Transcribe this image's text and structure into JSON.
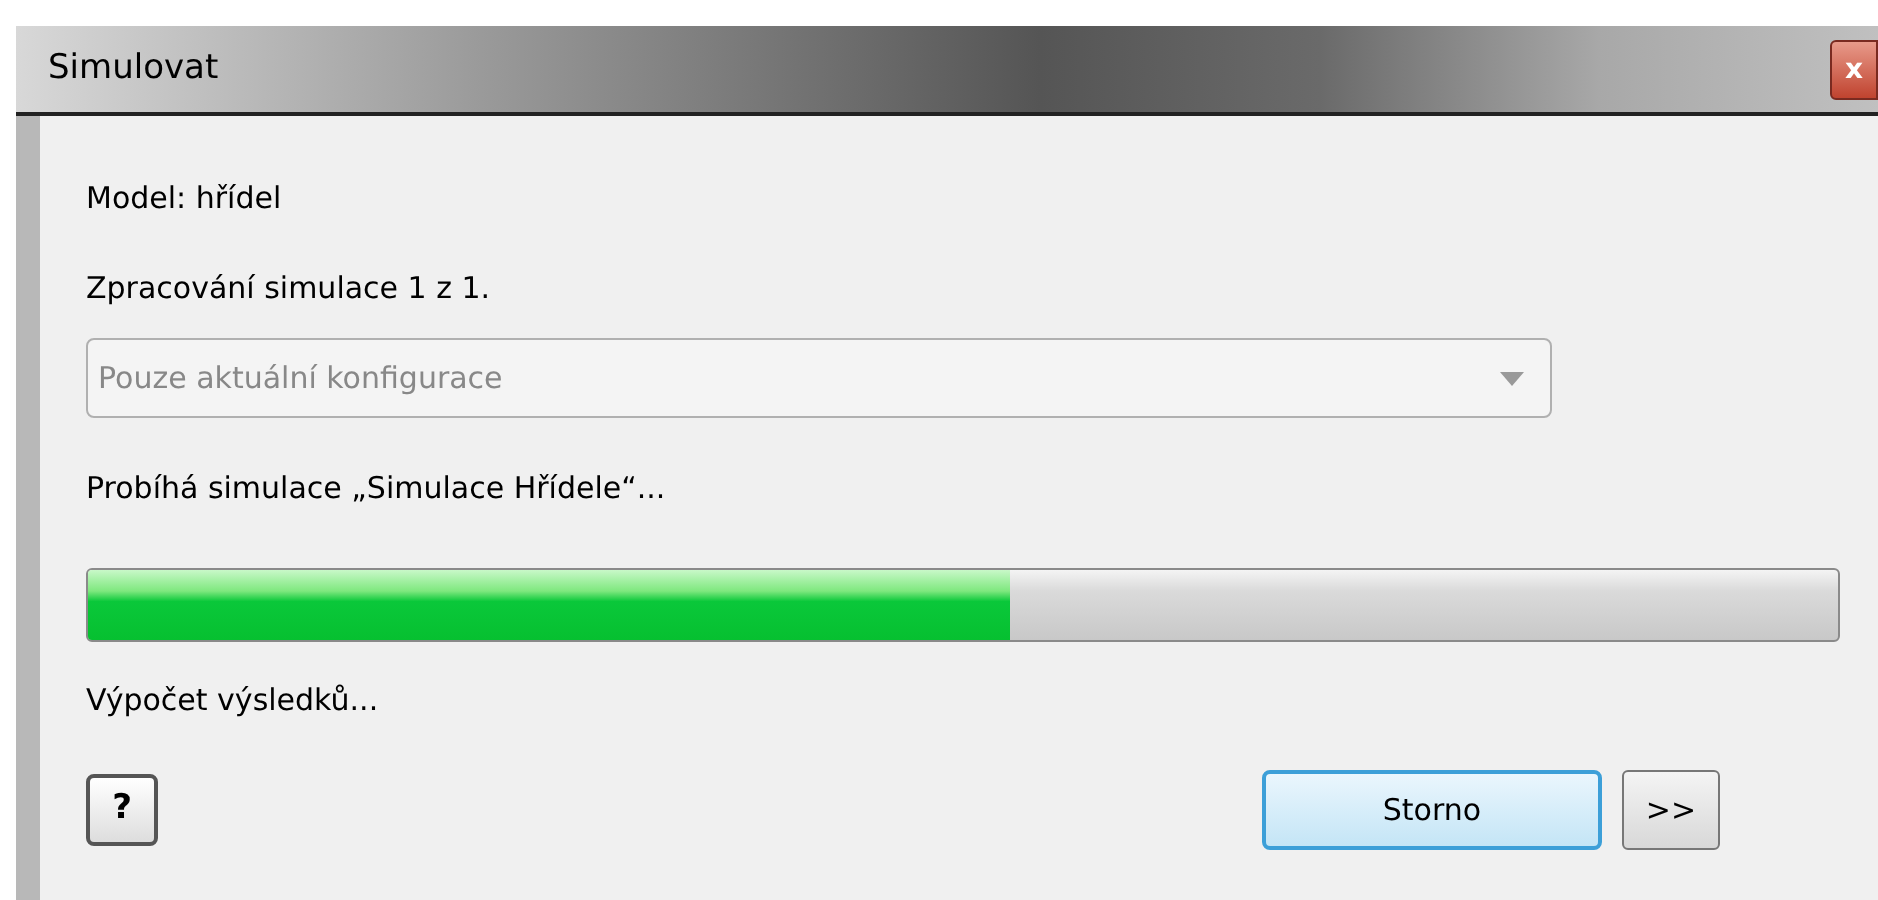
{
  "window": {
    "title": "Simulovat",
    "close": "x"
  },
  "model_label": "Model: hřídel",
  "processing": "Zpracování simulace 1 z 1.",
  "dropdown": {
    "value": "Pouze aktuální konfigurace",
    "disabled": true
  },
  "running": "Probíhá simulace „Simulace Hřídele“...",
  "progress": {
    "level": 0.527
  },
  "status": "Výpočet výsledků...",
  "buttons": [
    {
      "kind": "help",
      "label": "?"
    },
    {
      "kind": "default",
      "label": "Storno"
    },
    {
      "kind": "more",
      "label": ">>"
    }
  ]
}
